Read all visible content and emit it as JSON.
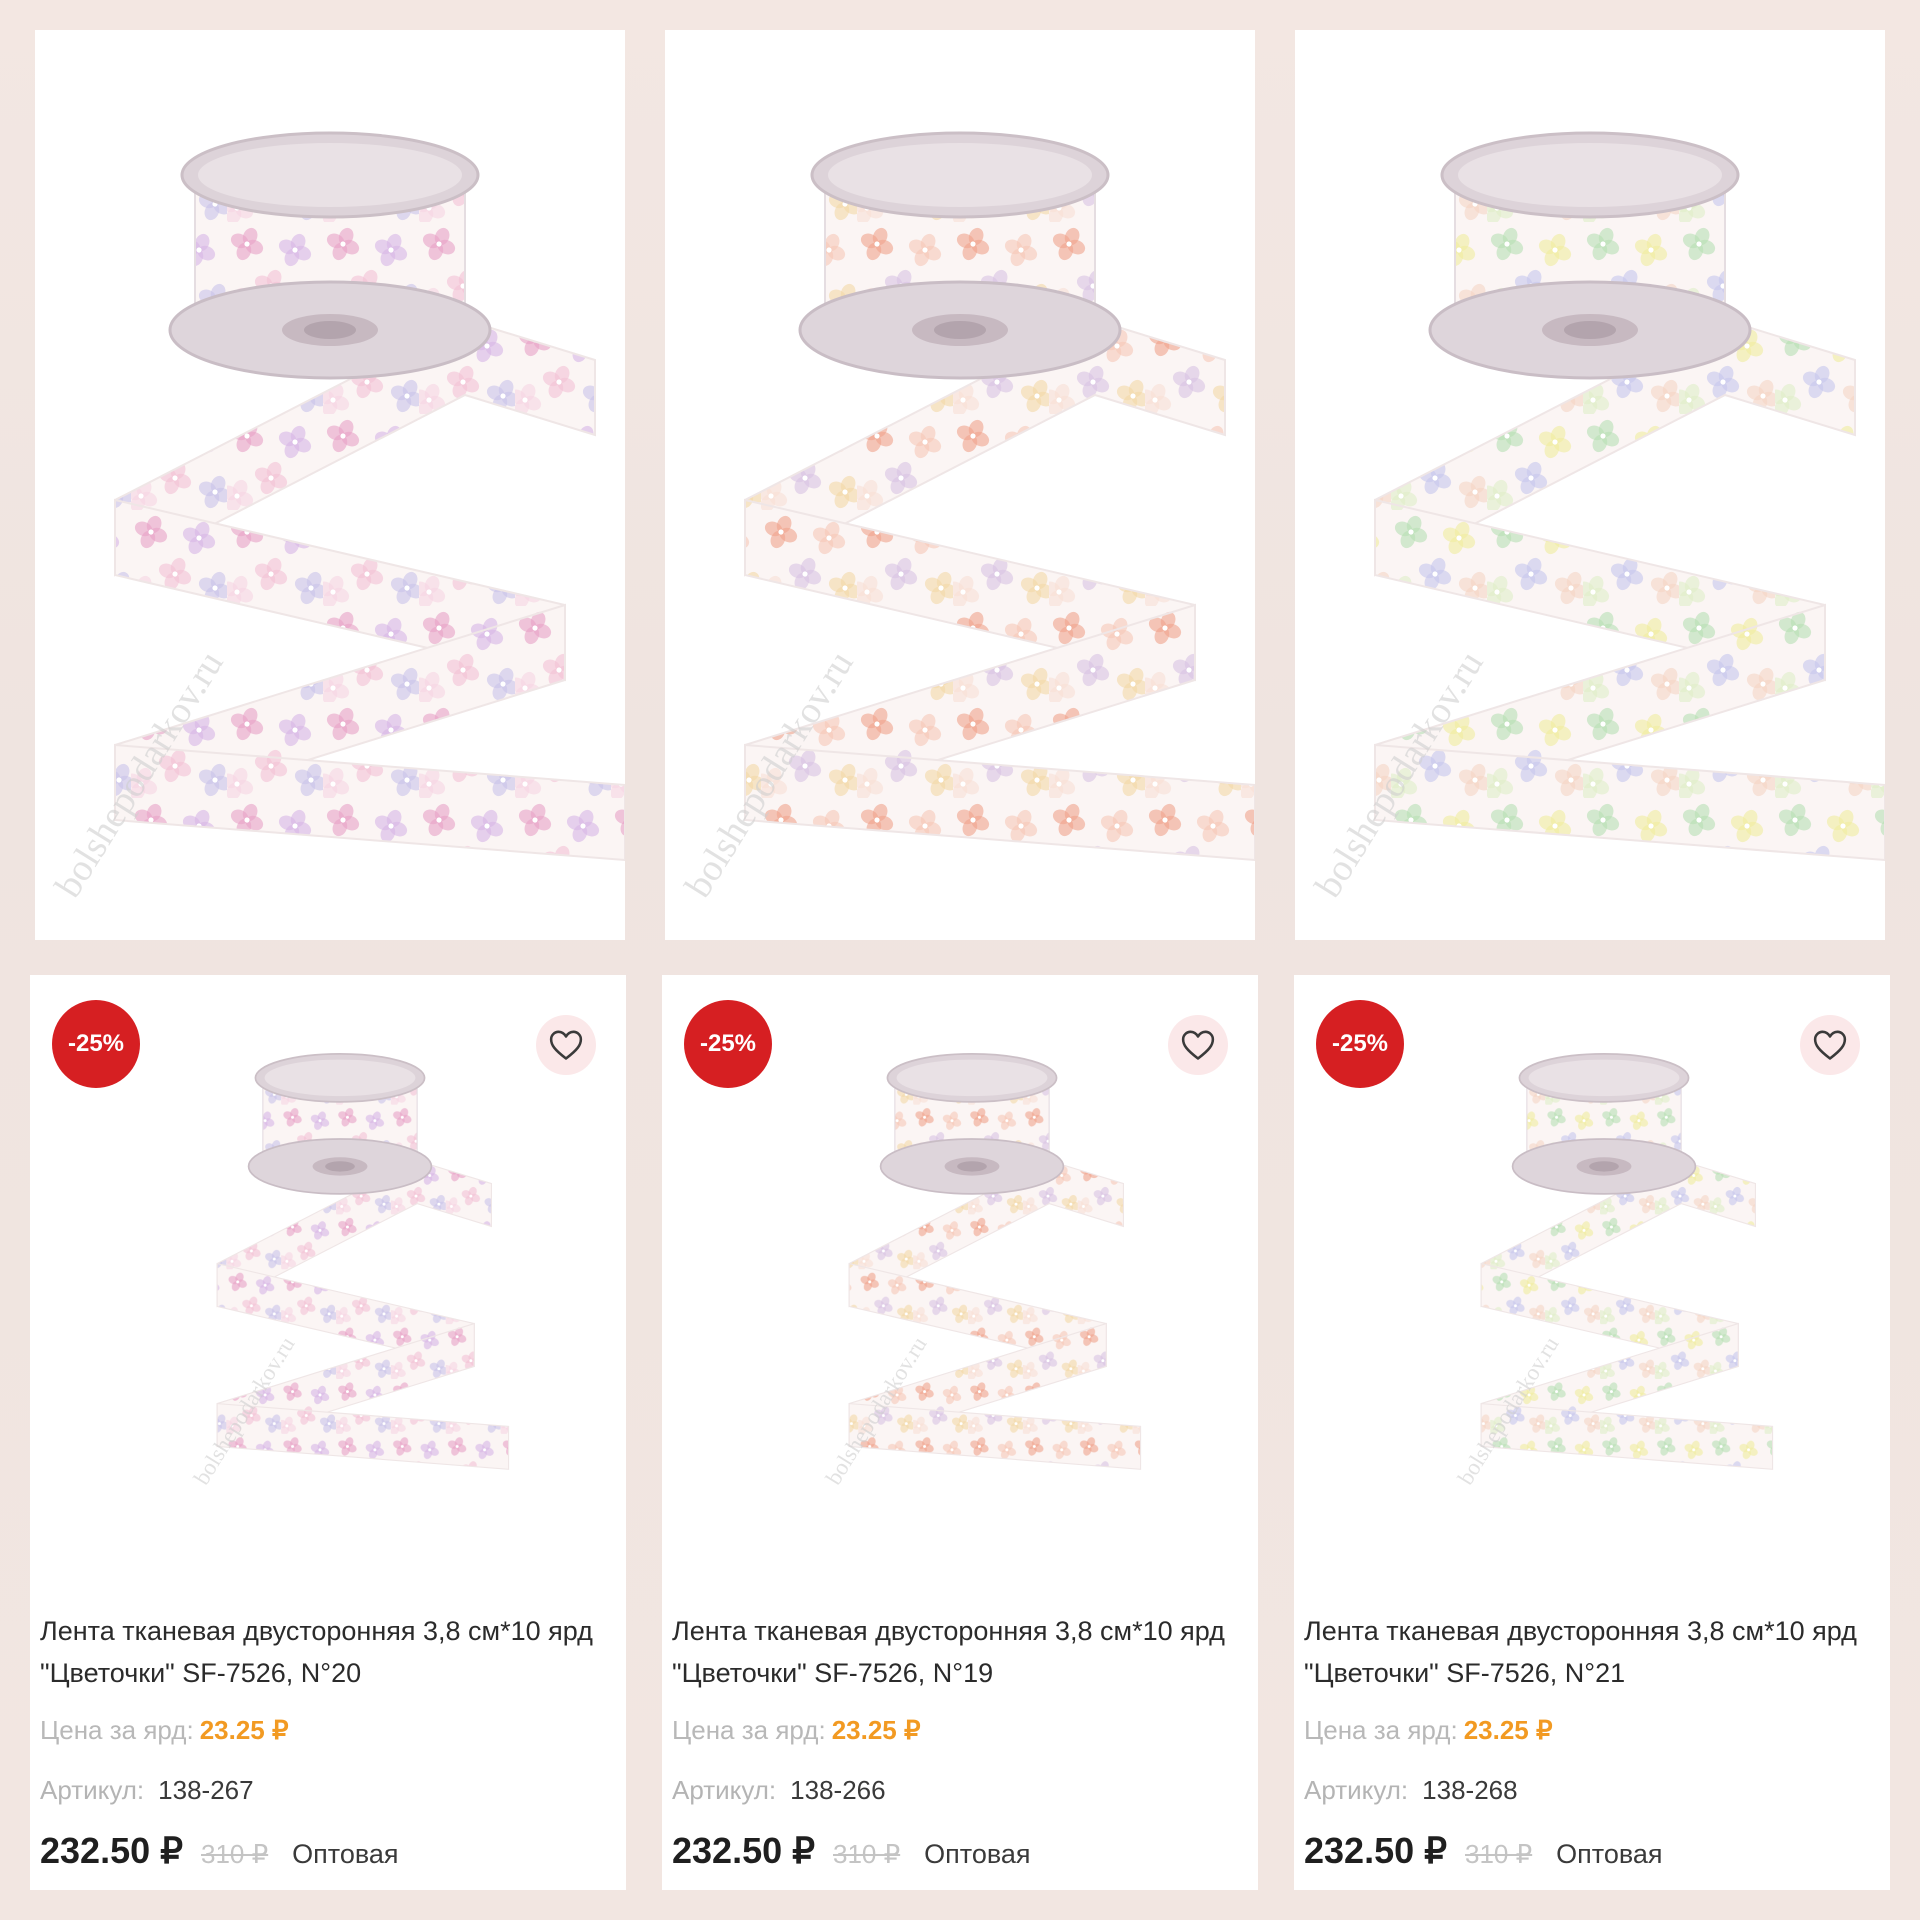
{
  "colors": {
    "badge": "#d61f22",
    "price_highlight": "#f29a22",
    "palettes": [
      [
        "#e8a2c7",
        "#d7b6e6",
        "#f3c1d6",
        "#c9c3ea",
        "#f7d6e2"
      ],
      [
        "#f0a38c",
        "#f6c8b8",
        "#d9c3e3",
        "#f3d9a6",
        "#f9e0d6"
      ],
      [
        "#b7e0b4",
        "#f0ec9e",
        "#c6c6ec",
        "#f5d5c4",
        "#dfeec8"
      ]
    ]
  },
  "photos": [
    {
      "watermark": "bolshepodarkov.ru"
    },
    {
      "watermark": "bolshepodarkov.ru"
    },
    {
      "watermark": "bolshepodarkov.ru"
    }
  ],
  "products": [
    {
      "badge": "-25%",
      "title": "Лента тканевая двусторонняя 3,8 см*10 ярд \"Цветочки\" SF-7526, N°20",
      "price_label": "Цена за ярд:",
      "price_per_yard": "23.25 ₽",
      "sku_label": "Артикул:",
      "sku": "138-267",
      "price": "232.50 ₽",
      "old_price": "310 ₽",
      "wholesale": "Оптовая",
      "watermark": "bolshepodarkov.ru"
    },
    {
      "badge": "-25%",
      "title": "Лента тканевая двусторонняя 3,8 см*10 ярд \"Цветочки\" SF-7526, N°19",
      "price_label": "Цена за ярд:",
      "price_per_yard": "23.25 ₽",
      "sku_label": "Артикул:",
      "sku": "138-266",
      "price": "232.50 ₽",
      "old_price": "310 ₽",
      "wholesale": "Оптовая",
      "watermark": "bolshepodarkov.ru"
    },
    {
      "badge": "-25%",
      "title": "Лента тканевая двусторонняя 3,8 см*10 ярд \"Цветочки\" SF-7526, N°21",
      "price_label": "Цена за ярд:",
      "price_per_yard": "23.25 ₽",
      "sku_label": "Артикул:",
      "sku": "138-268",
      "price": "232.50 ₽",
      "old_price": "310 ₽",
      "wholesale": "Оптовая",
      "watermark": "bolshepodarkov.ru"
    }
  ]
}
